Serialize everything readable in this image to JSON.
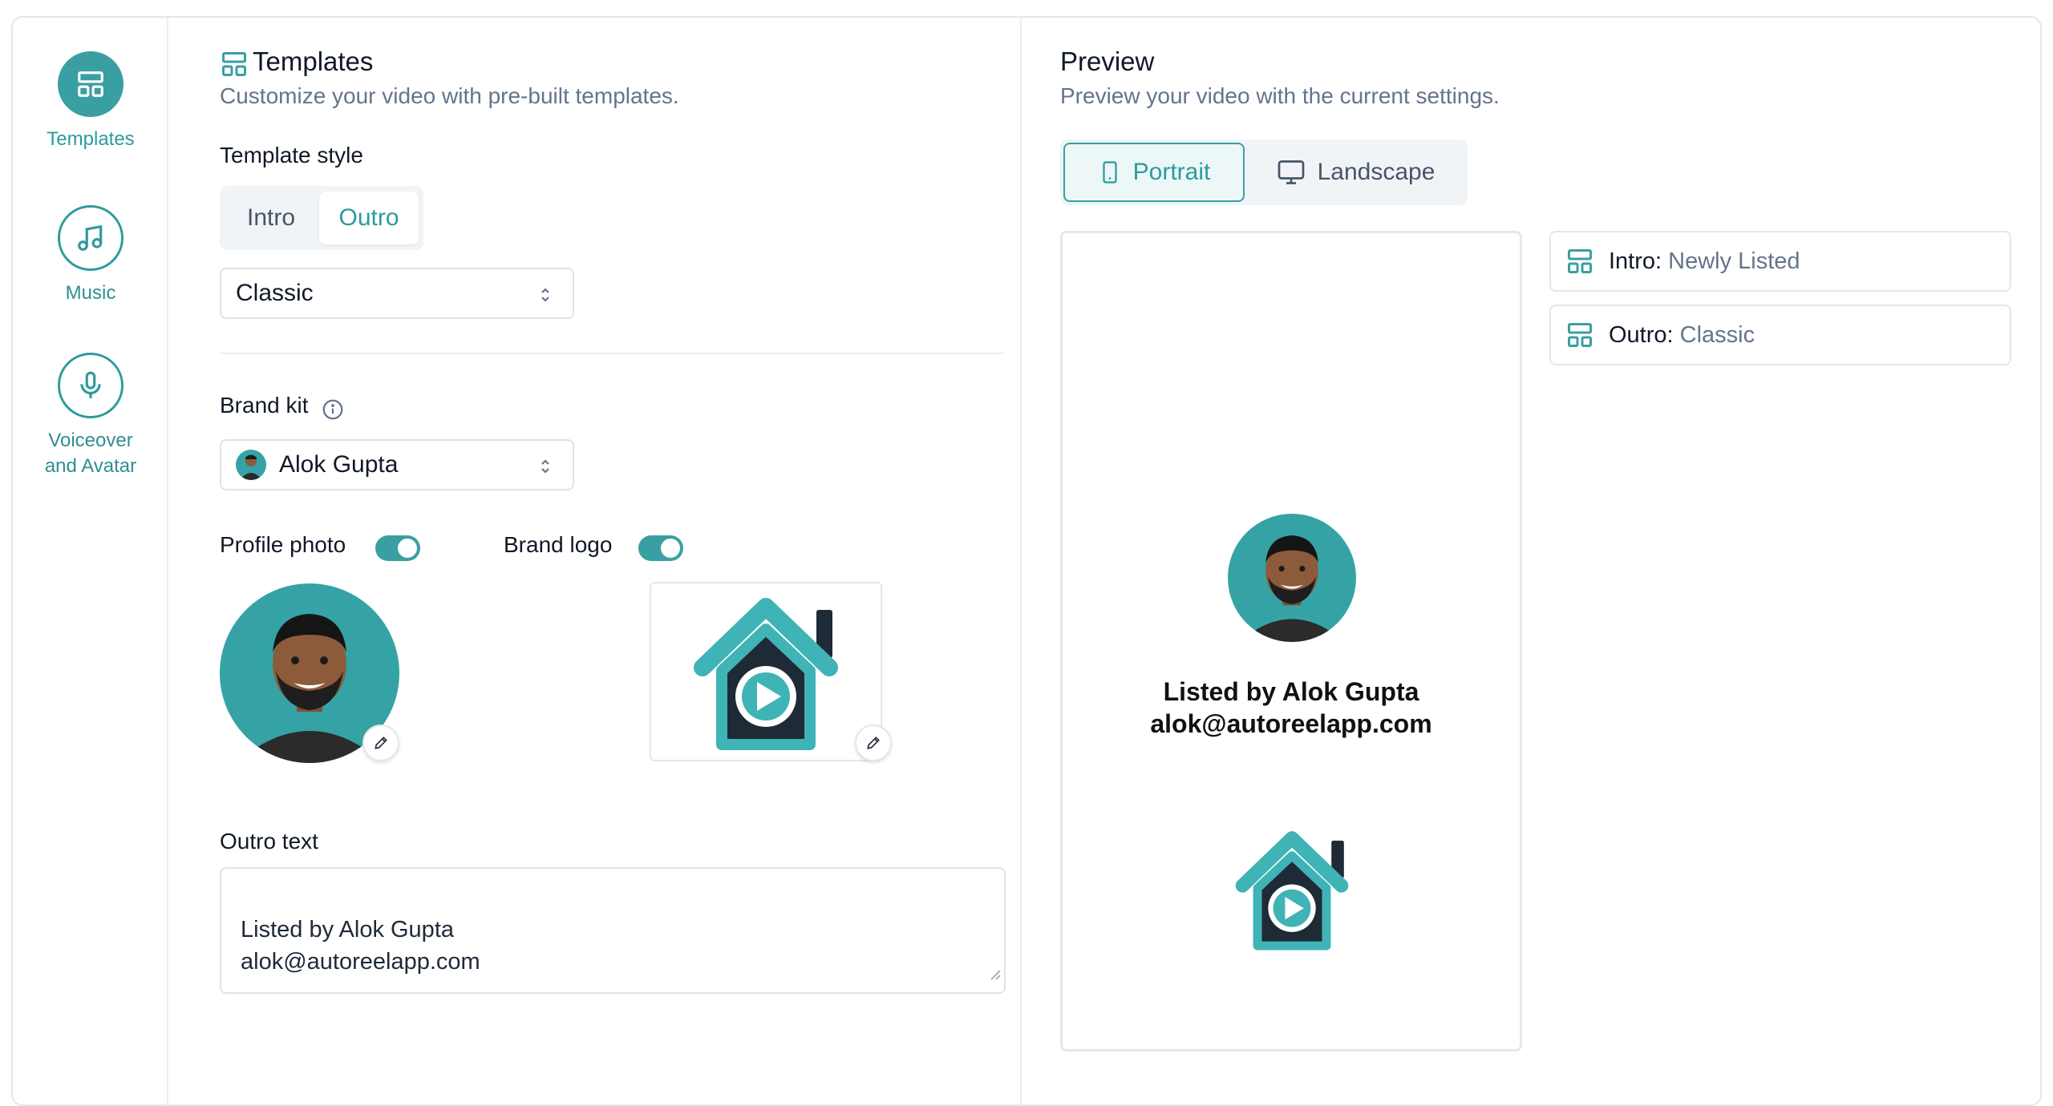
{
  "sidebar": {
    "items": [
      {
        "label": "Templates",
        "icon": "layout-icon",
        "active": true
      },
      {
        "label": "Music",
        "icon": "music-note-icon",
        "active": false
      },
      {
        "label": "Voiceover and Avatar",
        "icon": "microphone-icon",
        "active": false
      }
    ]
  },
  "templates": {
    "title": "Templates",
    "subtitle": "Customize your video with pre-built templates.",
    "template_style_label": "Template style",
    "style_tabs": [
      "Intro",
      "Outro"
    ],
    "selected_tab": "Outro",
    "style_select_value": "Classic",
    "brand_kit_label": "Brand kit",
    "brand_kit_value": "Alok Gupta",
    "profile_photo_label": "Profile photo",
    "profile_photo_enabled": true,
    "brand_logo_label": "Brand logo",
    "brand_logo_enabled": true,
    "outro_text_label": "Outro text",
    "outro_text_value": "Listed by Alok Gupta\nalok@autoreelapp.com"
  },
  "preview": {
    "title": "Preview",
    "subtitle": "Preview your video with the current settings.",
    "orientation_options": [
      "Portrait",
      "Landscape"
    ],
    "selected_orientation": "Portrait",
    "phone_text_line1": "Listed by Alok Gupta",
    "phone_text_line2": "alok@autoreelapp.com",
    "intro_key": "Intro:",
    "intro_value": "Newly Listed",
    "outro_key": "Outro:",
    "outro_value": "Classic"
  },
  "colors": {
    "accent": "#3a9fa2",
    "accent_text": "#2a9b9e",
    "logo_dark": "#1f2a37",
    "logo_teal": "#3fb3b5",
    "muted_text": "#64748b"
  }
}
